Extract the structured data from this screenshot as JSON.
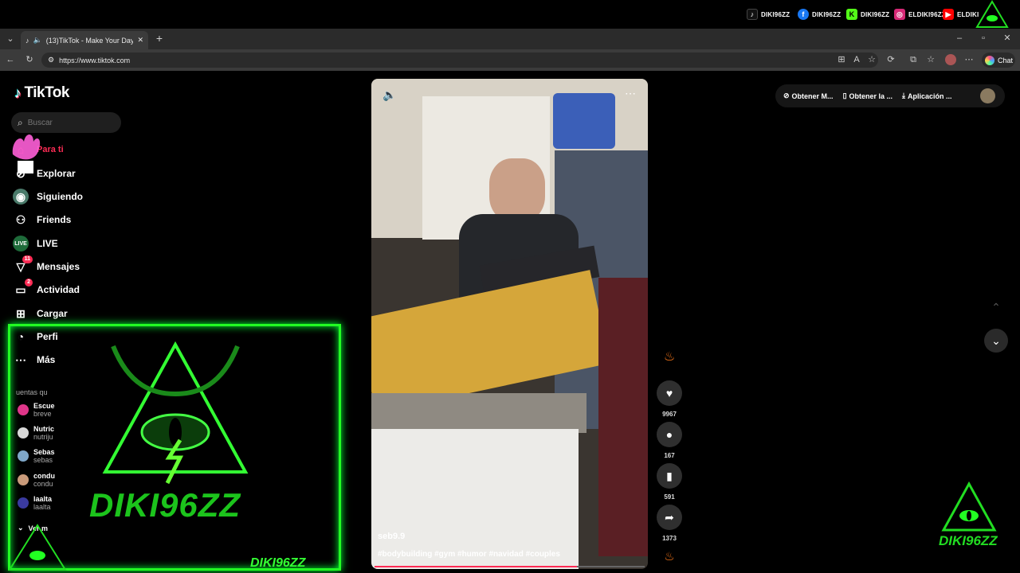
{
  "social_bar": [
    {
      "icon": "tiktok-icon",
      "label": "DIKI96ZZ",
      "color": "#ffffff"
    },
    {
      "icon": "facebook-icon",
      "label": "DIKI96ZZ",
      "color": "#1877f2"
    },
    {
      "icon": "kick-icon",
      "label": "DIKI96ZZ",
      "color": "#53fc18"
    },
    {
      "icon": "instagram-icon",
      "label": "ELDIKI96ZZ",
      "color": "#d62976"
    },
    {
      "icon": "youtube-icon",
      "label": "ELDIKI",
      "color": "#ff0000"
    }
  ],
  "browser": {
    "tab_title": "(13)TikTok - Make Your Day",
    "url": "https://www.tiktok.com",
    "chat_label": "Chat"
  },
  "sidebar": {
    "logo": "TikTok",
    "search_placeholder": "Buscar",
    "nav": [
      {
        "icon": "home-icon",
        "label": "Para ti",
        "active": true
      },
      {
        "icon": "compass-icon",
        "label": "Explorar"
      },
      {
        "icon": "following-icon",
        "label": "Siguiendo"
      },
      {
        "icon": "friends-icon",
        "label": "Friends"
      },
      {
        "icon": "live-icon",
        "label": "LIVE"
      },
      {
        "icon": "messages-icon",
        "label": "Mensajes",
        "badge": "11"
      },
      {
        "icon": "activity-icon",
        "label": "Actividad",
        "badge": "2"
      },
      {
        "icon": "upload-icon",
        "label": "Cargar"
      },
      {
        "icon": "profile-icon",
        "label": "Perfi"
      },
      {
        "icon": "more-icon",
        "label": "Más"
      }
    ],
    "accounts_title": "uentas qu",
    "accounts": [
      {
        "name": "Escue",
        "handle": "breve",
        "color": "#e0368a"
      },
      {
        "name": "Nutric",
        "handle": "nutriju",
        "color": "#d9d9d9"
      },
      {
        "name": "Sebas",
        "handle": "sebas",
        "color": "#7fa7c9"
      },
      {
        "name": "condu",
        "handle": "condu",
        "color": "#c99a7a"
      },
      {
        "name": "laalta",
        "handle": "laalta",
        "color": "#3a3aa0"
      }
    ],
    "see_more": "Ver m"
  },
  "header": {
    "actions": [
      "Obtener M...",
      "Obtener la ...",
      "Aplicación ..."
    ]
  },
  "video": {
    "username": "seb9.9",
    "hashtags": "#bodybuilding #gym #humor #navidad #couples",
    "progress": 0.75,
    "likes": "9967",
    "comments": "167",
    "saves": "591",
    "shares": "1373"
  },
  "overlay": {
    "brand": "DIKI96ZZ",
    "bottom_brand": "DIKI96ZZ",
    "corner_brand": "DIKI96ZZ"
  },
  "colors": {
    "accent": "#fe2c55",
    "overlay_green": "#22ff22"
  }
}
